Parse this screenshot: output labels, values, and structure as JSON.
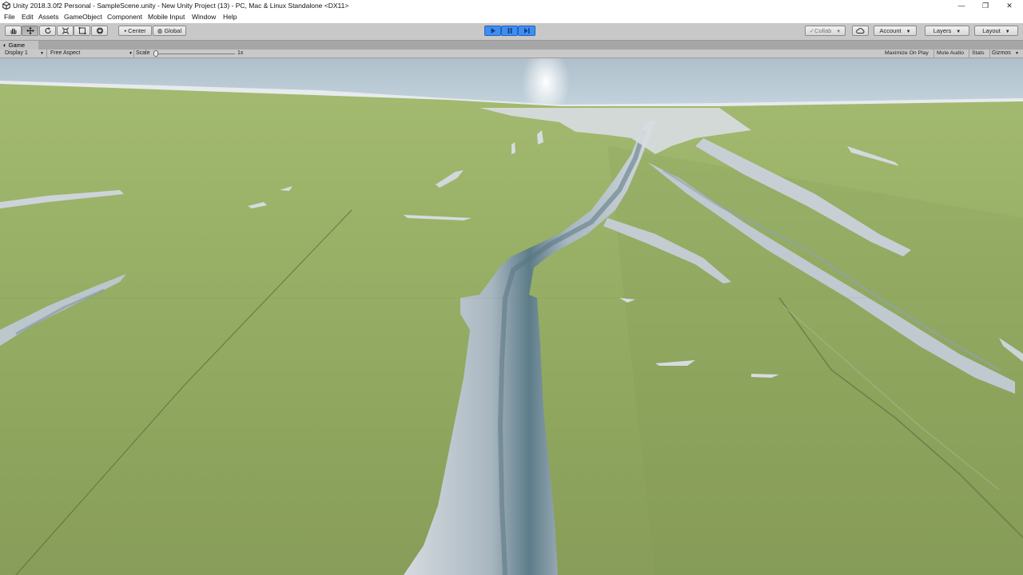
{
  "window": {
    "title": "Unity 2018.3.0f2 Personal - SampleScene.unity - New Unity Project (13) - PC, Mac & Linux Standalone <DX11>",
    "controls": {
      "minimize": "—",
      "restore": "❐",
      "close": "✕"
    }
  },
  "menu": {
    "items": [
      "File",
      "Edit",
      "Assets",
      "GameObject",
      "Component",
      "Mobile Input",
      "Window",
      "Help"
    ]
  },
  "toolbar": {
    "tools": [
      "hand-tool-icon",
      "move-tool-icon",
      "rotate-tool-icon",
      "scale-tool-icon",
      "rect-tool-icon",
      "transform-tool-icon"
    ],
    "active_tool": "move-tool-icon",
    "pivot_label": "Center",
    "space_label": "Global",
    "play_state": "playing",
    "collab_label": "Collab",
    "account_label": "Account",
    "layers_label": "Layers",
    "layout_label": "Layout",
    "colors": {
      "play_active": "#3c8ef5",
      "toolbar_bg": "#c8c8c8"
    }
  },
  "game_view": {
    "tab_label": "Game",
    "display_label": "Display 1",
    "aspect_label": "Free Aspect",
    "scale_label": "Scale",
    "scale_value": "1x",
    "scale_fraction": 0.0,
    "maximize_label": "Maximize On Play",
    "mute_label": "Mute Audio",
    "stats_label": "Stats",
    "gizmos_label": "Gizmos",
    "colors": {
      "grass": "#93ad64",
      "sky": "#b9ccd8",
      "water": "#b8c2cc",
      "water_deep": "#5f7f8c"
    }
  }
}
